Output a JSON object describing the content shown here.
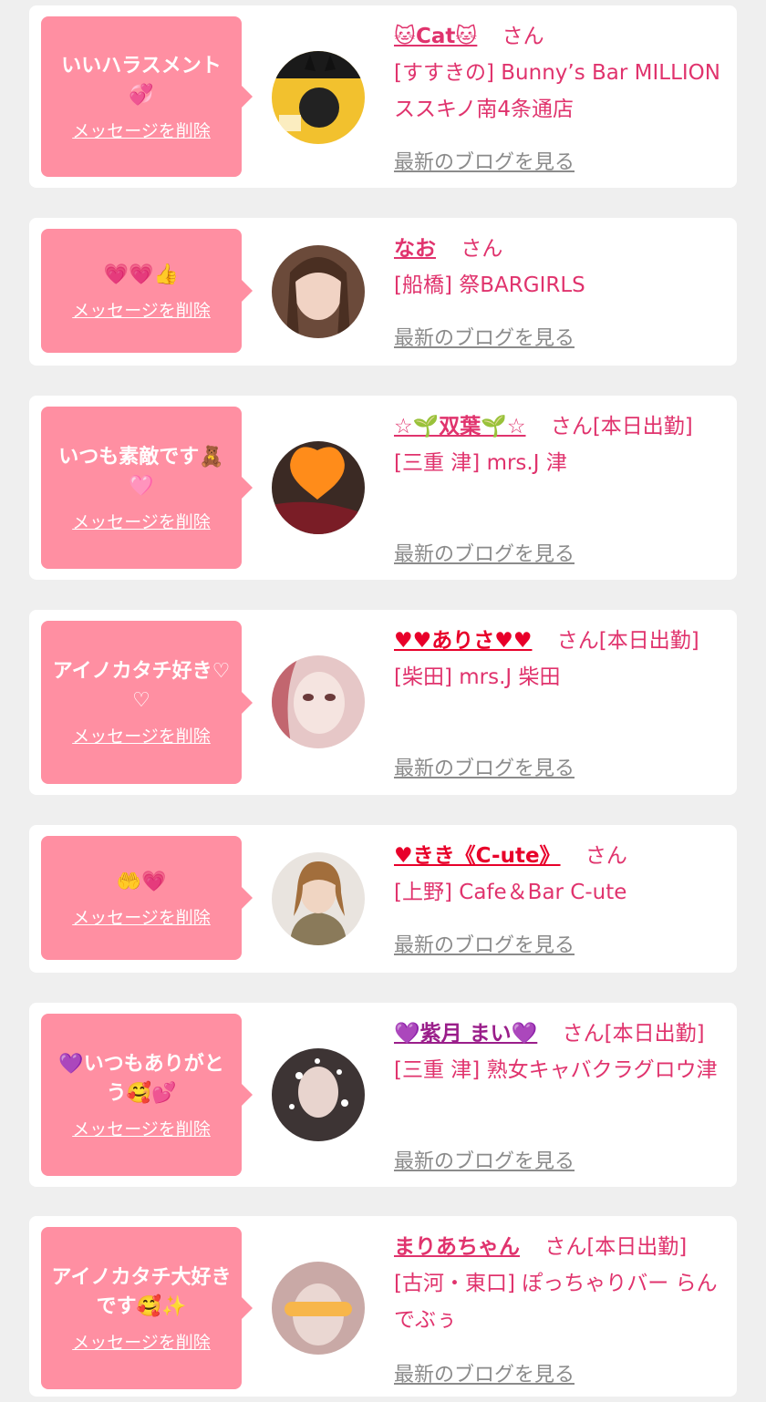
{
  "colors": {
    "page_bg": "#efefef",
    "bubble_bg": "#ff8fa2",
    "name_color": "#e0336d",
    "blog_link_color": "#8b8b8b"
  },
  "delete_label": "メッセージを削除",
  "blog_label": "最新のブログを見る",
  "messages": [
    {
      "message": "いいハラスメント💞",
      "name": "🐱Cat🐱",
      "name_suffix": "さん",
      "shop": "[すすきの] Bunny’s Bar MILLION ススキノ南4条通店",
      "avatar_icon": "avatar-photo"
    },
    {
      "message": "💗💗👍",
      "name": "なお",
      "name_suffix": "さん",
      "shop": "[船橋] 祭BARGIRLS",
      "avatar_icon": "avatar-photo"
    },
    {
      "message": "いつも素敵です🧸🩷",
      "name": "☆🌱双葉🌱☆",
      "name_suffix": "さん[本日出勤]",
      "shop": "[三重 津] mrs.J 津",
      "avatar_icon": "avatar-photo"
    },
    {
      "message": "アイノカタチ好き♡♡",
      "name": "♥♥ありさ♥♥",
      "name_suffix": "さん[本日出勤]",
      "shop": "[柴田] mrs.J 柴田",
      "avatar_icon": "avatar-photo"
    },
    {
      "message": "🤲💗",
      "name": "♥きき《C-ute》",
      "name_suffix": "さん",
      "shop": "[上野] Cafe＆Bar C-ute",
      "avatar_icon": "avatar-photo"
    },
    {
      "message": "💜いつもありがとう🥰💕",
      "name": "💜紫月 まい💜",
      "name_suffix": "さん[本日出勤]",
      "shop": "[三重 津] 熟女キャバクラグロウ津",
      "avatar_icon": "avatar-photo"
    },
    {
      "message": "アイノカタチ大好きです🥰✨",
      "name": "まりあちゃん",
      "name_suffix": "さん[本日出勤]",
      "shop": "[古河・東口] ぽっちゃりバー らんでぶぅ",
      "avatar_icon": "avatar-photo"
    }
  ]
}
